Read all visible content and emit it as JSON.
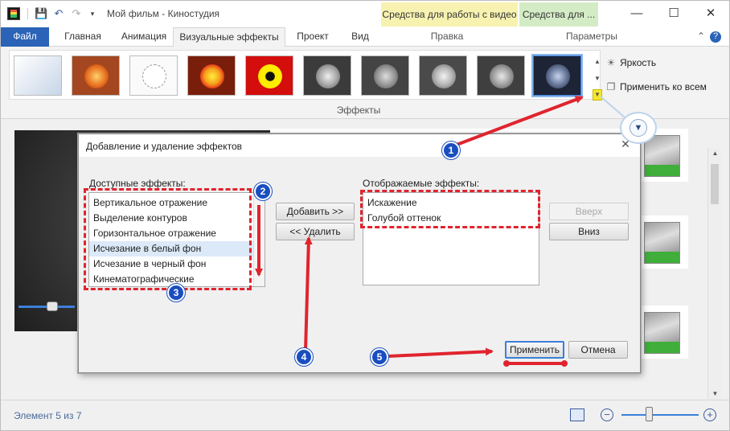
{
  "window": {
    "title": "Мой фильм - Киностудия",
    "context_tabs": {
      "video_tools": "Средства для работы с видео",
      "other_tools": "Средства для ..."
    },
    "context_groups": {
      "edit": "Правка",
      "params": "Параметры"
    },
    "controls": {
      "minimize": "—",
      "maximize": "☐",
      "close": "✕"
    }
  },
  "tabs": [
    "Файл",
    "Главная",
    "Анимация",
    "Визуальные эффекты",
    "Проект",
    "Вид"
  ],
  "help_icon": "?",
  "ribbon": {
    "brightness": "Яркость",
    "apply_all": "Применить ко всем",
    "group_label": "Эффекты",
    "effect_thumbnails": [
      "none",
      "warm",
      "sketch",
      "cyanotype-warm",
      "threshold",
      "gray",
      "gray-dark",
      "gray-light",
      "gray-mono",
      "blue-tint"
    ]
  },
  "dialog": {
    "title": "Добавление и удаление эффектов",
    "available_label": "Доступные эффекты:",
    "available": [
      "Вертикальное отражение",
      "Выделение контуров",
      "Горизонтальное отражение",
      "Исчезание в белый фон",
      "Исчезание в черный фон",
      "Кинематографические"
    ],
    "selected_available_index": 3,
    "displayed_label": "Отображаемые эффекты:",
    "displayed": [
      "Искажение",
      "Голубой оттенок"
    ],
    "add_button": "Добавить >>",
    "remove_button": "<< Удалить",
    "up_button": "Вверх",
    "down_button": "Вниз",
    "apply_button": "Применить",
    "cancel_button": "Отмена"
  },
  "status": {
    "text": "Элемент 5 из 7",
    "zoom_out": "−",
    "zoom_in": "+"
  },
  "annotations": [
    "1",
    "2",
    "3",
    "4",
    "5"
  ],
  "colors": {
    "accent": "#2a63b7",
    "annotation_red": "#e0242e",
    "badge_blue": "#1a4ec0",
    "video_context": "#f7f2b0",
    "other_context": "#d4ecc6"
  }
}
